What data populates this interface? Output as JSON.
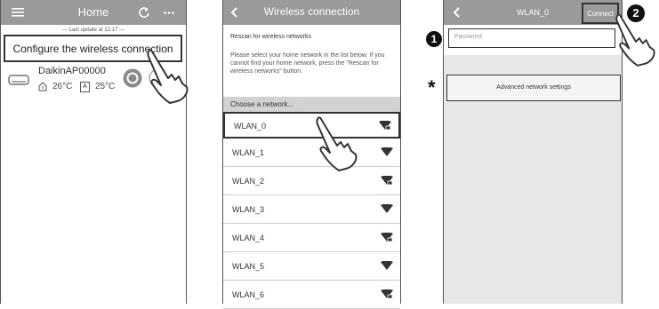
{
  "screen1": {
    "title": "Home",
    "last_update": "--- Last update at 12:17 ---",
    "configure_label": "Configure the wireless connection",
    "device": {
      "name": "DaikinAP00000",
      "indoor_temp": "26°C",
      "outdoor_label": "A",
      "outdoor_temp": "25°C"
    },
    "icons": [
      "menu-icon",
      "refresh-icon",
      "more-icon",
      "house-icon",
      "power-icon",
      "hand-pointer-icon"
    ]
  },
  "screen2": {
    "title": "Wireless connection",
    "rescan_label": "Rescan for wireless networks",
    "instructions": "Please select your home network in the list below. If you cannot find your home network, press the \"Rescan for wireless networks\" button.",
    "choose_header": "Choose a network...",
    "networks": [
      {
        "name": "WLAN_0",
        "locked": true
      },
      {
        "name": "WLAN_1",
        "locked": false
      },
      {
        "name": "WLAN_2",
        "locked": true
      },
      {
        "name": "WLAN_3",
        "locked": false
      },
      {
        "name": "WLAN_4",
        "locked": true
      },
      {
        "name": "WLAN_5",
        "locked": false
      },
      {
        "name": "WLAN_6",
        "locked": true
      }
    ]
  },
  "screen3": {
    "title": "WLAN_0",
    "connect_label": "Connect",
    "password_placeholder": "Password",
    "advanced_label": "Advanced network settings"
  },
  "callouts": {
    "step1": "1",
    "step2": "2",
    "asterisk": "*"
  },
  "colors": {
    "topbar": "#9a9a9a",
    "list_header": "#cfcfcf",
    "callout": "#111111"
  }
}
